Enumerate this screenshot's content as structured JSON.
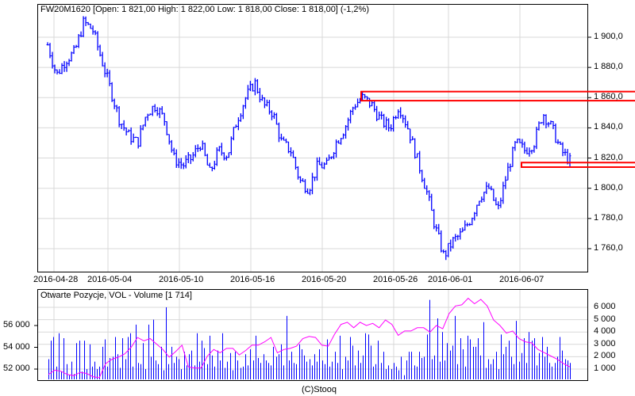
{
  "main_title": "FW20M1620 [Open: 1 821,00  High: 1 822,00  Low: 1 818,00  Close: 1 818,00] (-1,2%)",
  "lower_title": "Otwarte Pozycje, VOL - Volume [1 714]",
  "footer": "(C)Stooq",
  "colors": {
    "price": "#0000ff",
    "volume": "#0000ff",
    "oi": "#ff00ff",
    "zone": "#ff0000",
    "grid": "#d8d8d8"
  },
  "chart_data": [
    {
      "type": "line",
      "title": "FW20M1620",
      "series_name": "Price (OHLC bars)",
      "x_ticks": [
        "2016-04-28",
        "2016-05-04",
        "2016-05-10",
        "2016-05-16",
        "2016-05-20",
        "2016-05-26",
        "2016-06-01",
        "2016-06-07"
      ],
      "y_ticks": [
        "1 900,0",
        "1 880,0",
        "1 860,0",
        "1 840,0",
        "1 820,0",
        "1 800,0",
        "1 780,0",
        "1 760,0"
      ],
      "ylim": [
        1745,
        1922
      ],
      "waypoints": [
        1895,
        1875,
        1885,
        1890,
        1910,
        1905,
        1885,
        1865,
        1845,
        1835,
        1830,
        1850,
        1855,
        1845,
        1820,
        1815,
        1820,
        1830,
        1810,
        1825,
        1822,
        1845,
        1860,
        1870,
        1855,
        1850,
        1830,
        1825,
        1805,
        1800,
        1815,
        1815,
        1830,
        1840,
        1855,
        1860,
        1855,
        1845,
        1840,
        1855,
        1840,
        1820,
        1800,
        1775,
        1755,
        1765,
        1770,
        1780,
        1795,
        1800,
        1785,
        1810,
        1830,
        1825,
        1830,
        1850,
        1840,
        1825,
        1818
      ],
      "resistance_zone": [
        1858,
        1864
      ],
      "support_zone": [
        1814,
        1817
      ]
    },
    {
      "type": "bar",
      "title": "Otwarte Pozycje, VOL - Volume [1 714]",
      "left_ticks": [
        "56 000",
        "54 000",
        "52 000"
      ],
      "right_ticks": [
        "6 000",
        "5 000",
        "4 000",
        "3 000",
        "2 000",
        "1 000"
      ],
      "volume": [
        1800,
        3300,
        3600,
        1200,
        3900,
        800,
        3500,
        1400,
        500,
        1600,
        600,
        3100,
        3300,
        800,
        3300,
        1000,
        3000,
        1200,
        1600,
        1000,
        1200,
        2800,
        3400,
        1200,
        1900,
        2000,
        3600,
        2200,
        1100,
        3500,
        1800,
        3600,
        3900,
        1200,
        4600,
        1500,
        1400,
        3100,
        1000,
        4600,
        2000,
        5000,
        1700,
        1400,
        2800,
        900,
        6000,
        1400,
        2800,
        1500,
        2000,
        1800,
        1000,
        2400,
        1300,
        2200,
        2500,
        1300,
        3900,
        1600,
        3300,
        2700,
        1400,
        3700,
        2100,
        1200,
        2500,
        1700,
        3900,
        1100,
        1600,
        2300,
        900,
        2400,
        1700,
        1100,
        1200,
        2200,
        1300,
        2600,
        1700,
        3700,
        1900,
        1500,
        2200,
        1700,
        1500,
        1300,
        2800,
        2000,
        2200,
        3000,
        1300,
        5300,
        1700,
        2400,
        1500,
        1400,
        3000,
        2600,
        2100,
        1600,
        1800,
        1300,
        2200,
        1600,
        2600,
        1700,
        1400,
        3400,
        1200,
        1600,
        2400,
        1500,
        3700,
        1000,
        2000,
        1700,
        3600,
        2900,
        1300,
        2500,
        1500,
        2100,
        3900,
        3800,
        2900,
        1200,
        1400,
        3300,
        1500,
        2400,
        1000,
        1300,
        1000,
        1500,
        1200,
        900,
        2000,
        500,
        1700,
        2400,
        2400,
        1300,
        1200,
        2400,
        1900,
        2000,
        3800,
        6600,
        1800,
        2100,
        5100,
        1600,
        4000,
        1700,
        3100,
        2500,
        2900,
        5300,
        1400,
        3500,
        2600,
        1200,
        3700,
        3400,
        2800,
        2800,
        3500,
        2100,
        4800,
        1100,
        1800,
        1400,
        1800,
        2400,
        1000,
        3800,
        2200,
        2800,
        3300,
        2000,
        1400,
        4900,
        1600,
        2300,
        3500,
        1500,
        4000,
        3300,
        3500,
        1300,
        2300,
        3600,
        2000,
        2800,
        1500,
        1200,
        1500,
        2000,
        3600,
        2500,
        1800,
        1700,
        1500
      ],
      "open_interest": [
        51500,
        51900,
        51800,
        51500,
        51400,
        51700,
        51600,
        51300,
        51200,
        52500,
        52900,
        53100,
        53400,
        54000,
        54900,
        54600,
        54800,
        54300,
        53800,
        53100,
        53600,
        54200,
        52200,
        52100,
        52100,
        53200,
        53800,
        53500,
        53900,
        53900,
        53300,
        53700,
        54200,
        54200,
        54500,
        54900,
        53500,
        53800,
        53900,
        54100,
        54800,
        55000,
        54900,
        54200,
        54100,
        55200,
        56100,
        56300,
        55800,
        56300,
        56000,
        56200,
        55800,
        56500,
        56100,
        55100,
        55500,
        55500,
        55800,
        55800,
        55400,
        56000,
        55700,
        57100,
        57800,
        57900,
        58500,
        58000,
        58400,
        57800,
        56500,
        56000,
        55300,
        55500,
        54800,
        54500,
        54400,
        53800,
        53500,
        53200,
        52900,
        52500,
        52200
      ]
    }
  ]
}
